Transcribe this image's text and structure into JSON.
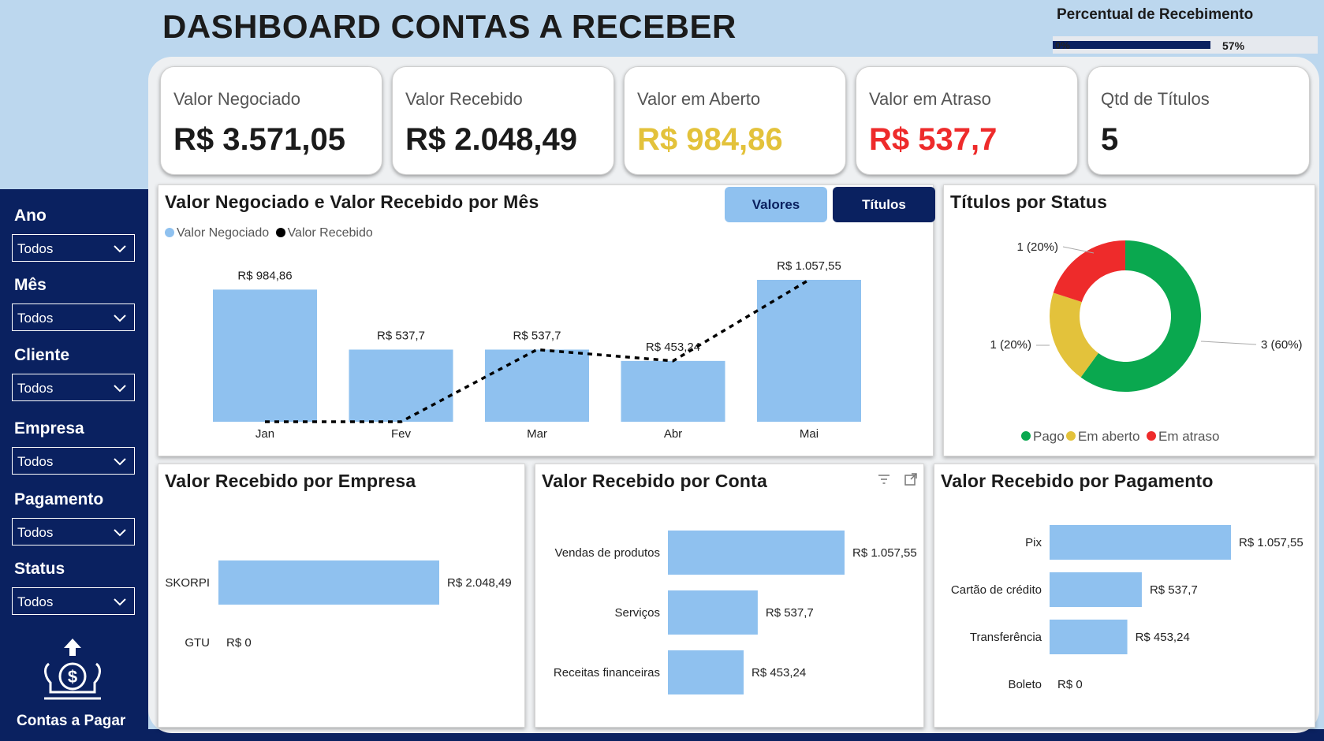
{
  "header": {
    "title": "DASHBOARD CONTAS A RECEBER",
    "percent_title": "Percentual de Recebimento",
    "percent_min": "0%",
    "percent_value": "57%",
    "percent_fraction": 0.57
  },
  "kpis": [
    {
      "label": "Valor Negociado",
      "value": "R$ 3.571,05",
      "color": "#1b1b1b"
    },
    {
      "label": "Valor Recebido",
      "value": "R$ 2.048,49",
      "color": "#1b1b1b"
    },
    {
      "label": "Valor em Aberto",
      "value": "R$ 984,86",
      "color": "#e3c23b"
    },
    {
      "label": "Valor em Atraso",
      "value": "R$ 537,7",
      "color": "#ee2b2b"
    },
    {
      "label": "Qtd de Títulos",
      "value": "5",
      "color": "#1b1b1b"
    }
  ],
  "filters": [
    {
      "label": "Ano",
      "value": "Todos"
    },
    {
      "label": "Mês",
      "value": "Todos"
    },
    {
      "label": "Cliente",
      "value": "Todos"
    },
    {
      "label": "Empresa",
      "value": "Todos"
    },
    {
      "label": "Pagamento",
      "value": "Todos"
    },
    {
      "label": "Status",
      "value": "Todos"
    }
  ],
  "nav": {
    "contas_pagar": "Contas a Pagar"
  },
  "toggles": {
    "valores": "Valores",
    "titulos": "Títulos"
  },
  "colors": {
    "navy": "#0a2160",
    "bar": "#8fc1ef",
    "pago": "#0aa84f",
    "aberto": "#e3c23b",
    "atraso": "#ee2b2b"
  },
  "chart_data": [
    {
      "type": "bar",
      "title": "Valor Negociado e Valor Recebido por Mês",
      "categories": [
        "Jan",
        "Fev",
        "Mar",
        "Abr",
        "Mai"
      ],
      "series": [
        {
          "name": "Valor Negociado",
          "kind": "bar",
          "values": [
            984.86,
            537.7,
            537.7,
            453.24,
            1057.55
          ],
          "labels": [
            "R$ 984,86",
            "R$ 537,7",
            "R$ 537,7",
            "R$ 453,24",
            "R$ 1.057,55"
          ]
        },
        {
          "name": "Valor Recebido",
          "kind": "line",
          "values": [
            0,
            0,
            537.7,
            453.24,
            1057.55
          ]
        }
      ],
      "legend": "top-left"
    },
    {
      "type": "pie",
      "title": "Títulos por Status",
      "slices": [
        {
          "name": "Pago",
          "value": 3,
          "label": "3 (60%)",
          "color": "#0aa84f"
        },
        {
          "name": "Em aberto",
          "value": 1,
          "label": "1 (20%)",
          "color": "#e3c23b"
        },
        {
          "name": "Em atraso",
          "value": 1,
          "label": "1 (20%)",
          "color": "#ee2b2b"
        }
      ],
      "legend": "bottom"
    },
    {
      "type": "bar",
      "orientation": "horizontal",
      "title": "Valor Recebido por Empresa",
      "categories": [
        "SKORPI",
        "GTU"
      ],
      "values": [
        2048.49,
        0
      ],
      "labels": [
        "R$ 2.048,49",
        "R$ 0"
      ]
    },
    {
      "type": "bar",
      "orientation": "horizontal",
      "title": "Valor Recebido por Conta",
      "categories": [
        "Vendas de produtos",
        "Serviços",
        "Receitas financeiras"
      ],
      "values": [
        1057.55,
        537.7,
        453.24
      ],
      "labels": [
        "R$ 1.057,55",
        "R$ 537,7",
        "R$ 453,24"
      ]
    },
    {
      "type": "bar",
      "orientation": "horizontal",
      "title": "Valor Recebido por Pagamento",
      "categories": [
        "Pix",
        "Cartão de crédito",
        "Transferência",
        "Boleto"
      ],
      "values": [
        1057.55,
        537.7,
        453.24,
        0
      ],
      "labels": [
        "R$ 1.057,55",
        "R$ 537,7",
        "R$ 453,24",
        "R$ 0"
      ]
    }
  ]
}
